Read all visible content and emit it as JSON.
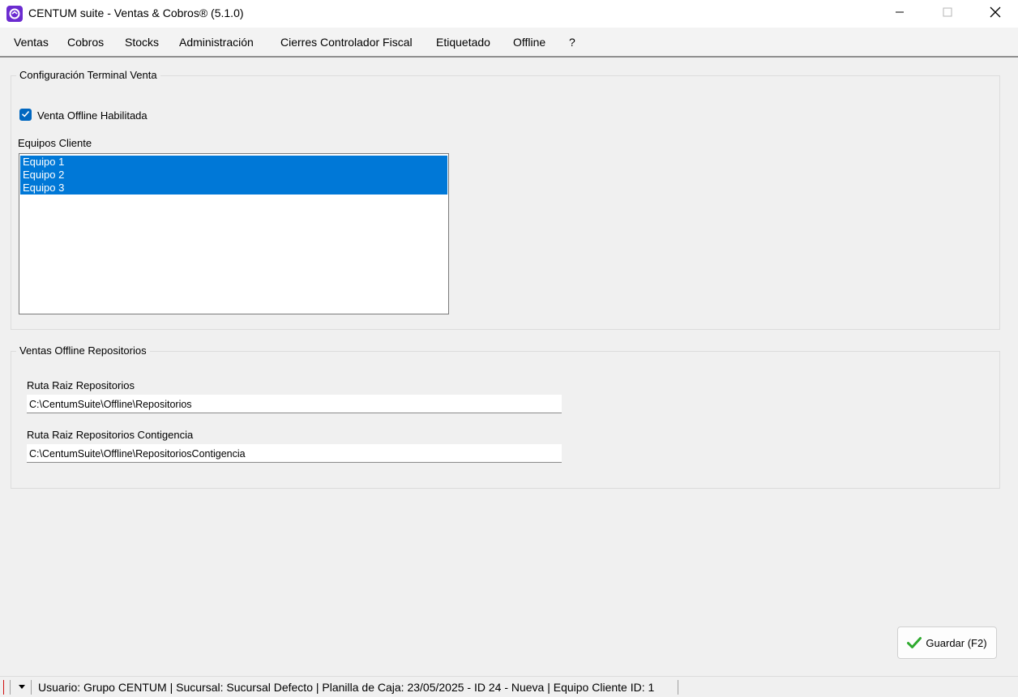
{
  "window": {
    "title": "CENTUM suite - Ventas & Cobros® (5.1.0)",
    "minimize_icon": "minimize-icon",
    "maximize_icon": "maximize-icon",
    "close_icon": "close-icon"
  },
  "menu": {
    "items": [
      "Ventas",
      "Cobros",
      "Stocks",
      "Administración",
      "Cierres Controlador Fiscal",
      "Etiquetado",
      "Offline",
      "?"
    ]
  },
  "terminal_group": {
    "legend": "Configuración Terminal Venta",
    "offline_checkbox_label": "Venta Offline Habilitada",
    "offline_checked": true,
    "equipos_label": "Equipos Cliente",
    "equipos": [
      "Equipo 1",
      "Equipo 2",
      "Equipo 3"
    ]
  },
  "repos_group": {
    "legend": "Ventas Offline Repositorios",
    "ruta_label": "Ruta Raiz Repositorios",
    "ruta_value": "C:\\CentumSuite\\Offline\\Repositorios",
    "ruta_contingencia_label": "Ruta Raiz Repositorios Contigencia",
    "ruta_contingencia_value": "C:\\CentumSuite\\Offline\\RepositoriosContigencia"
  },
  "actions": {
    "save_label": "Guardar (F2)",
    "save_icon": "checkmark-icon"
  },
  "status": {
    "text": "Usuario: Grupo CENTUM | Sucursal: Sucursal Defecto | Planilla de Caja: 23/05/2025 - ID 24 - Nueva | Equipo Cliente ID: 1"
  },
  "colors": {
    "selection": "#0078d7",
    "checkbox_accent": "#0067c0",
    "app_icon": "#6b2bd0",
    "save_check": "#2eaa2e",
    "status_marker": "#d01010"
  }
}
